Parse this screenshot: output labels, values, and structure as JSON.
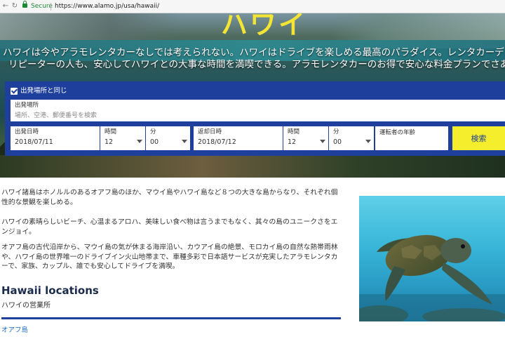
{
  "browser": {
    "secure_label": "Secure",
    "url_text": "https://www.alamo.jp/usa/hawaii/"
  },
  "hero": {
    "title": "ハワイ",
    "line1": "ハワイは今やアラモレンタカーなしでは考えられない。ハワイはドライブを楽しめる最高のパラダイス。レンタカーデビューの人",
    "line2": "リピーターの人も、安心してハワイとの大事な時間を満喫できる。アラモレンタカーのお得で安心な料金プランでさあ、ドライ"
  },
  "search": {
    "same_location_label": "出発場所と同じ",
    "same_location_checked": true,
    "pickup_location": {
      "label": "出発場所",
      "placeholder": "場所、空港、郵便番号を検索"
    },
    "pickup_date": {
      "label": "出発日時",
      "value": "2018/07/11"
    },
    "pickup_hour": {
      "label": "時間",
      "value": "12"
    },
    "pickup_min": {
      "label": "分",
      "value": "00"
    },
    "return_date": {
      "label": "返却日時",
      "value": "2018/07/12"
    },
    "return_hour": {
      "label": "時間",
      "value": "12"
    },
    "return_min": {
      "label": "分",
      "value": "00"
    },
    "driver_age": {
      "label": "運転者の年齢"
    },
    "search_button": "検索",
    "colors": {
      "panel": "#1e3f9b",
      "button": "#f4ee2c"
    }
  },
  "content": {
    "paragraphs": [
      "ハワイ諸島はホノルルのあるオアフ島のほか、マウイ島やハワイ島など８つの大きな島からなり、それぞれ個性的な景観を楽しめる。",
      "ハワイの素晴らしいビーチ、心温まるアロハ、美味しい食べ物は言うまでもなく、其々の島のユニークさをエンジョイ。",
      "オアフ島の古代沿岸から、マウイ島の気が休まる海岸沿い、カウアイ島の絶景、モロカイ島の自然な熱帯雨林や、ハワイ島の世界唯一のドライブイン火山地帯まで、車種多彩で日本語サービスが充実したアラモレンタカーで、家族、カップル、誰でも安心してドライブを満喫。"
    ],
    "locations_title": "Hawaii locations",
    "locations_subtitle": "ハワイの営業所",
    "first_location": "オアフ島"
  },
  "icons": {
    "back": "back-arrow-icon",
    "forward": "forward-arrow-icon",
    "reload": "reload-icon",
    "lock": "lock-icon",
    "checkbox": "checkbox-checked-icon",
    "dropdown": "chevron-down-icon"
  }
}
